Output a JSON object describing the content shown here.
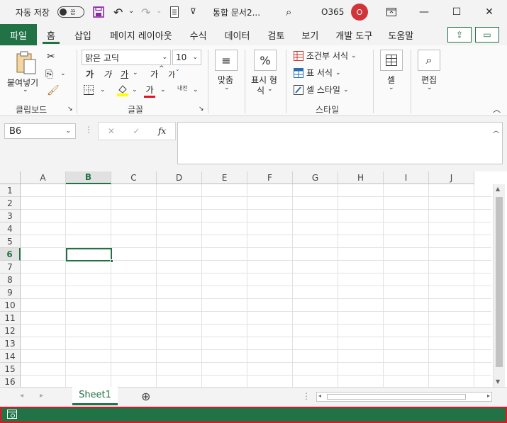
{
  "titlebar": {
    "autosave_label": "자동 저장",
    "autosave_state": "끔",
    "doc_title": "통합 문서2...",
    "account": "O365",
    "avatar_letter": "O"
  },
  "tabs": [
    "파일",
    "홈",
    "삽입",
    "페이지 레이아웃",
    "수식",
    "데이터",
    "검토",
    "보기",
    "개발 도구",
    "도움말"
  ],
  "ribbon": {
    "clipboard": {
      "paste_label": "붙여넣기",
      "group_label": "클립보드"
    },
    "font": {
      "font_name": "맑은 고딕",
      "font_size": "10",
      "bold": "가",
      "italic": "가",
      "underline": "가",
      "grow": "가",
      "shrink": "가",
      "color_glyph": "가",
      "phonetic": "내천",
      "group_label": "글꼴"
    },
    "alignment": {
      "label": "맞춤"
    },
    "number": {
      "label_line1": "표시 형",
      "label_line2": "식",
      "icon": "%"
    },
    "styles": {
      "conditional": "조건부 서식",
      "table": "표 서식",
      "cell": "셀 스타일",
      "group_label": "스타일"
    },
    "cells": {
      "label": "셀"
    },
    "editing": {
      "label": "편집"
    }
  },
  "formula_bar": {
    "name_box": "B6",
    "fx": "fx",
    "content": ""
  },
  "grid": {
    "columns": [
      "A",
      "B",
      "C",
      "D",
      "E",
      "F",
      "G",
      "H",
      "I",
      "J"
    ],
    "rows": [
      "1",
      "2",
      "3",
      "4",
      "5",
      "6",
      "7",
      "8",
      "9",
      "10",
      "11",
      "12",
      "13",
      "14",
      "15",
      "16"
    ],
    "selected_col": "B",
    "selected_row": "6"
  },
  "sheets": {
    "tabs": [
      "Sheet1"
    ],
    "add_icon": "⊕"
  },
  "colors": {
    "accent": "#217346",
    "status_border": "#e81123"
  }
}
